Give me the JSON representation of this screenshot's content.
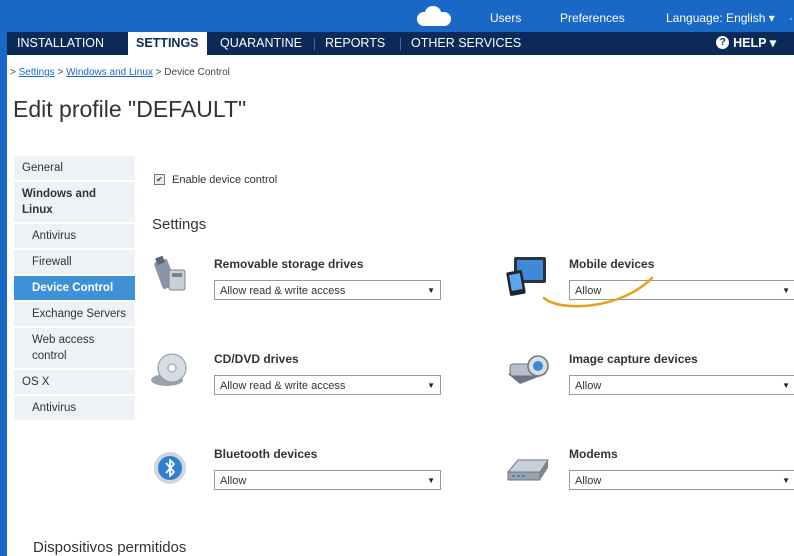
{
  "topbar": {
    "users": "Users",
    "preferences": "Preferences",
    "language": "Language: English ▾",
    "language_overflow": "·"
  },
  "nav": {
    "items": [
      "INSTALLATION",
      "SETTINGS",
      "QUARANTINE",
      "REPORTS",
      "OTHER SERVICES"
    ],
    "active": "SETTINGS",
    "help": "HELP ▾"
  },
  "breadcrumb": {
    "prefix": "> ",
    "settings": "Settings",
    "sep1": " > ",
    "windows_linux": "Windows and Linux",
    "sep2": " > ",
    "current": "Device Control"
  },
  "page_title": "Edit profile \"DEFAULT\"",
  "sidebar": {
    "items": [
      {
        "label": "General"
      },
      {
        "label": "Windows and Linux"
      },
      {
        "label": "Antivirus"
      },
      {
        "label": "Firewall"
      },
      {
        "label": "Device Control"
      },
      {
        "label": "Exchange Servers"
      },
      {
        "label": "Web access control"
      },
      {
        "label": "OS X"
      },
      {
        "label": "Antivirus"
      }
    ]
  },
  "enable_device_control": {
    "label": "Enable device control",
    "checked": true
  },
  "settings_heading": "Settings",
  "devices": [
    {
      "label": "Removable storage drives",
      "value": "Allow read & write access",
      "icon": "usb-drive-icon"
    },
    {
      "label": "Mobile devices",
      "value": "Allow",
      "icon": "mobile-devices-icon"
    },
    {
      "label": "CD/DVD drives",
      "value": "Allow read & write access",
      "icon": "cd-dvd-icon"
    },
    {
      "label": "Image capture devices",
      "value": "Allow",
      "icon": "camera-icon"
    },
    {
      "label": "Bluetooth devices",
      "value": "Allow",
      "icon": "bluetooth-icon"
    },
    {
      "label": "Modems",
      "value": "Allow",
      "icon": "modem-icon"
    }
  ],
  "footer_caption": "Dispositivos permitidos",
  "colors": {
    "brand_blue": "#1a68c6",
    "nav_dark": "#0b2a57",
    "sidebar_active": "#3e91d6",
    "highlight_swoosh": "#e5a11c"
  }
}
